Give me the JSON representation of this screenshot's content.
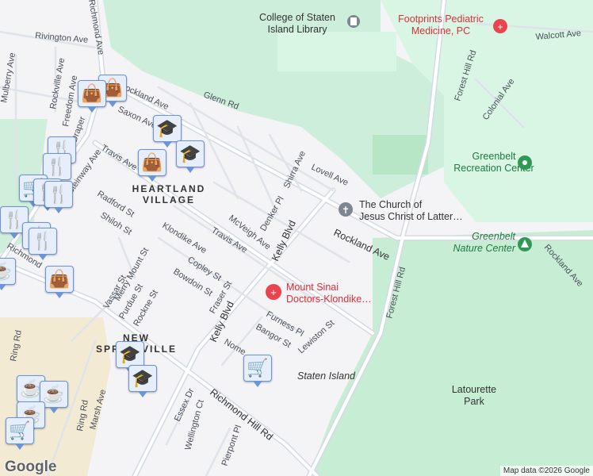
{
  "streets": [
    "Rivington Ave",
    "Richmond Ave",
    "Rockville Ave",
    "Mulberry Ave",
    "Freedom Ave",
    "Draper",
    "Rockland Ave",
    "Saxon Ave",
    "Glenn Rd",
    "Travis Ave",
    "Steinway Ave",
    "Radford St",
    "Shiloh St",
    "Klondike Ave",
    "Merry Mount St",
    "Travis Ave",
    "McVeigh Ave",
    "Denker Pl",
    "Shirra Ave",
    "Lovell Ave",
    "Kelly Blvd",
    "Rockland Ave",
    "Copley St",
    "Bowdoin St",
    "Vassar St",
    "Purdue St",
    "Rockne St",
    "Fraser St",
    "Kelly Blvd",
    "Furness Pl",
    "Bangor St",
    "Lewiston St",
    "Nome",
    "Forest Hill Rd",
    "Forest Hill Rd",
    "Walcott Ave",
    "Colonial Ave",
    "Rockland Ave",
    "Ring Rd",
    "Ring Rd",
    "Marsh Ave",
    "Essex Dr",
    "Wellington Ct",
    "Richmond Hill Rd",
    "Pierpont Pl",
    "Richmond"
  ],
  "places": {
    "library": [
      "College of Staten",
      "Island Library"
    ],
    "pediatric": [
      "Footprints Pediatric",
      "Medicine, PC"
    ],
    "greenbelt_rec": [
      "Greenbelt",
      "Recreation Center"
    ],
    "church": [
      "The Church of",
      "Jesus Christ of Latter…"
    ],
    "nature": [
      "Greenbelt",
      "Nature Center"
    ],
    "sinai": [
      "Mount Sinai",
      "Doctors-Klondike…"
    ],
    "latourette": [
      "Latourette",
      "Park"
    ],
    "staten": "Staten Island"
  },
  "neighborhoods": {
    "heartland": [
      "HEARTLAND",
      "VILLAGE"
    ],
    "springville": [
      "NEW",
      "SPRINGVILLE"
    ]
  },
  "markers": {
    "shopping": "shopping-bag",
    "school": "graduation-cap",
    "restaurant": "fork-knife",
    "cafe": "coffee-cup",
    "grocery": "shopping-cart"
  },
  "footer": {
    "logo": "Google",
    "attribution": "Map data ©2026 Google"
  },
  "colors": {
    "park": "#c9f0d6",
    "park_light": "#d9f6e4",
    "campus": "#f3ead4",
    "road": "#ffffff",
    "marker": "#0b4a6f"
  }
}
